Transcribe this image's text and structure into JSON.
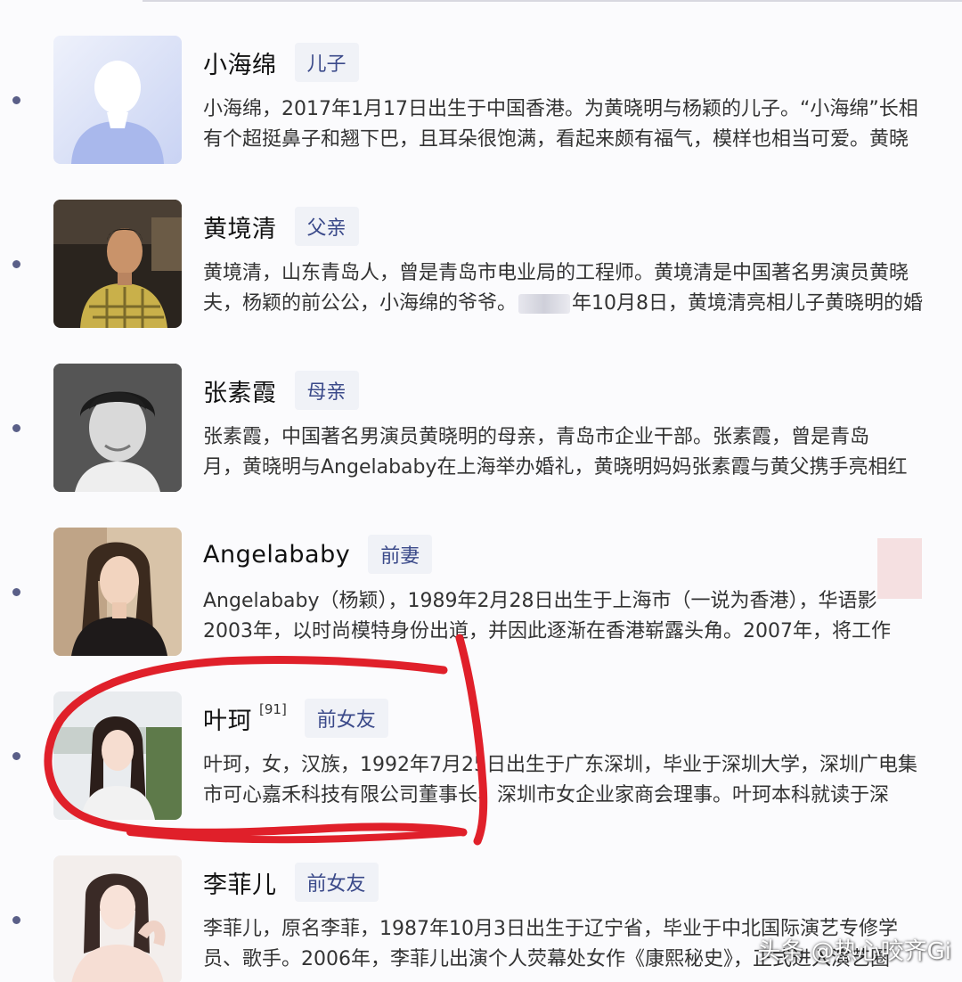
{
  "entries": [
    {
      "name": "小海绵",
      "ref": "",
      "relation": "儿子",
      "line1": "小海绵，2017年1月17日出生于中国香港。为黄晓明与杨颖的儿子。“小海绵”长相",
      "line2": "有个超挺鼻子和翘下巴，且耳朵很饱满，看起来颇有福气，模样也相当可爱。黄晓"
    },
    {
      "name": "黄境清",
      "ref": "",
      "relation": "父亲",
      "line1": "黄境清，山东青岛人，曾是青岛市电业局的工程师。黄境清是中国著名男演员黄晓",
      "line2_a": "夫，杨颖的前公公，小海绵的爷爷。",
      "line2_b": "年10月8日，黄境清亮相儿子黄晓明的婚"
    },
    {
      "name": "张素霞",
      "ref": "",
      "relation": "母亲",
      "line1": "张素霞，中国著名男演员黄晓明的母亲，青岛市企业干部。张素霞，曾是青岛",
      "line2": "月，黄晓明与Angelababy在上海举办婚礼，黄晓明妈妈张素霞与黄父携手亮相红"
    },
    {
      "name": "Angelababy",
      "ref": "",
      "relation": "前妻",
      "line1": "Angelababy（杨颖），1989年2月28日出生于上海市（一说为香港），华语影",
      "line2": "2003年，以时尚模特身份出道，并因此逐渐在香港崭露头角。2007年，将工作"
    },
    {
      "name": "叶珂",
      "ref": "[91]",
      "relation": "前女友",
      "line1": "叶珂，女，汉族，1992年7月25日出生于广东深圳，毕业于深圳大学，深圳广电集",
      "line2": "市可心嘉禾科技有限公司董事长、深圳市女企业家商会理事。叶珂本科就读于深"
    },
    {
      "name": "李菲儿",
      "ref": "",
      "relation": "前女友",
      "line1": "李菲儿，原名李菲，1987年10月3日出生于辽宁省，毕业于中北国际演艺专修学",
      "line2": "员、歌手。2006年，李菲儿出演个人荧幕处女作《康熙秘史》，正式进入演艺圈"
    }
  ],
  "watermark": "头条 @热心咬齐Gi",
  "colors": {
    "tag_bg": "#f0f2f7",
    "tag_text": "#3b4a8a",
    "timeline_dot": "#5a5f88",
    "highlight_circle": "#e0202a"
  }
}
